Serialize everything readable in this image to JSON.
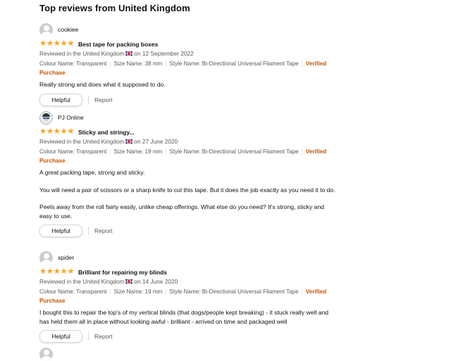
{
  "section_title": "Top reviews from United Kingdom",
  "labels": {
    "helpful": "Helpful",
    "report": "Report",
    "verified_purchase": "Verified Purchase"
  },
  "colors": {
    "star": "#f5a623",
    "verified": "#c45500",
    "muted_text": "#565959"
  },
  "reviews": [
    {
      "profile_name": "cookiee",
      "avatar": "default-avatar-icon",
      "stars": 5,
      "title": "Best tape for packing boxes",
      "location_text": "Reviewed in the United Kingdom",
      "date_text": "on 12 September 2022",
      "colour_name": "Colour Name: Transparent",
      "size_name": "Size Name: 38 mm",
      "style_name": "Style Name: Bi-Directional Universal Filament Tape",
      "body": [
        "Really strong and does what it supposed to do."
      ]
    },
    {
      "profile_name": "PJ Online",
      "avatar": "custom-avatar-icon",
      "stars": 5,
      "title": "Sticky and stringy...",
      "location_text": "Reviewed in the United Kingdom",
      "date_text": "on 27 June 2020",
      "colour_name": "Colour Name: Transparent",
      "size_name": "Size Name: 19 mm",
      "style_name": "Style Name: Bi-Directional Universal Filament Tape",
      "body": [
        "A great packing tape, strong and sticky.",
        "You will need a pair of scissors or a sharp knife to cut this tape. But it does the job exactly as you need it to do.",
        "Peels away from the roll fairly easily, unlike cheap offerings. What else do you need? It's strong, sticky and easy to use."
      ]
    },
    {
      "profile_name": "spider",
      "avatar": "default-avatar-icon",
      "stars": 5,
      "title": "Brilliant for repairing my blinds",
      "location_text": "Reviewed in the United Kingdom",
      "date_text": "on 14 June 2020",
      "colour_name": "Colour Name: Transparent",
      "size_name": "Size Name: 19 mm",
      "style_name": "Style Name: Bi-Directional Universal Filament Tape",
      "body": [
        "I bought this to repair the top's of my vertical blinds (that dogs/people kept breaking) - it stuck really well and has held them all in place without looking awful - brilliant - arrived on time and packaged well"
      ]
    },
    {
      "profile_name": "",
      "avatar": "default-avatar-icon"
    }
  ]
}
